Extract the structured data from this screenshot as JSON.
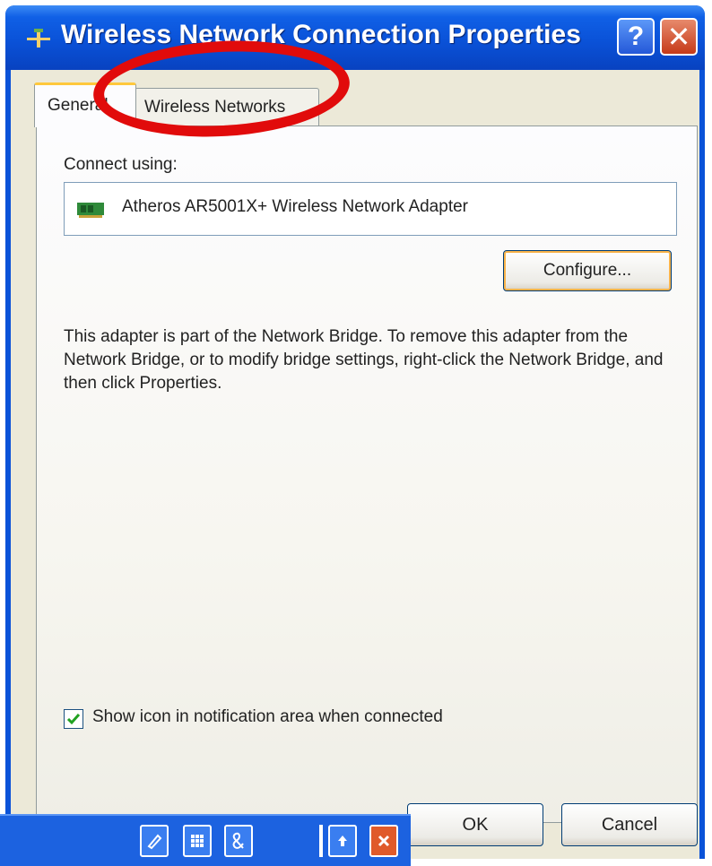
{
  "window": {
    "title": "Wireless Network Connection Properties",
    "title_icon": "network-connection-icon",
    "help_label": "?",
    "close_label": "✕"
  },
  "tabs": [
    {
      "label": "General",
      "selected": true
    },
    {
      "label": "Wireless Networks",
      "selected": false
    }
  ],
  "general": {
    "connect_using_label": "Connect using:",
    "adapter_icon": "network-adapter-icon",
    "adapter_name": "Atheros AR5001X+ Wireless Network Adapter",
    "configure_label": "Configure...",
    "info_text": "This adapter is part of the Network Bridge.  To remove this adapter from the Network Bridge, or to modify bridge settings, right-click the Network Bridge, and then click Properties.",
    "show_icon_label": "Show icon in notification area when connected",
    "show_icon_checked": true
  },
  "buttons": {
    "ok_label": "OK",
    "cancel_label": "Cancel"
  },
  "overlay_toolbar": {
    "buttons": [
      "pencil-icon",
      "keypad-icon",
      "ampersand-icon",
      "upload-icon",
      "close-icon"
    ]
  },
  "colors": {
    "titlebar": "#0a52d8",
    "annotation": "#e10b0b",
    "dialog_face": "#ece9d8"
  }
}
